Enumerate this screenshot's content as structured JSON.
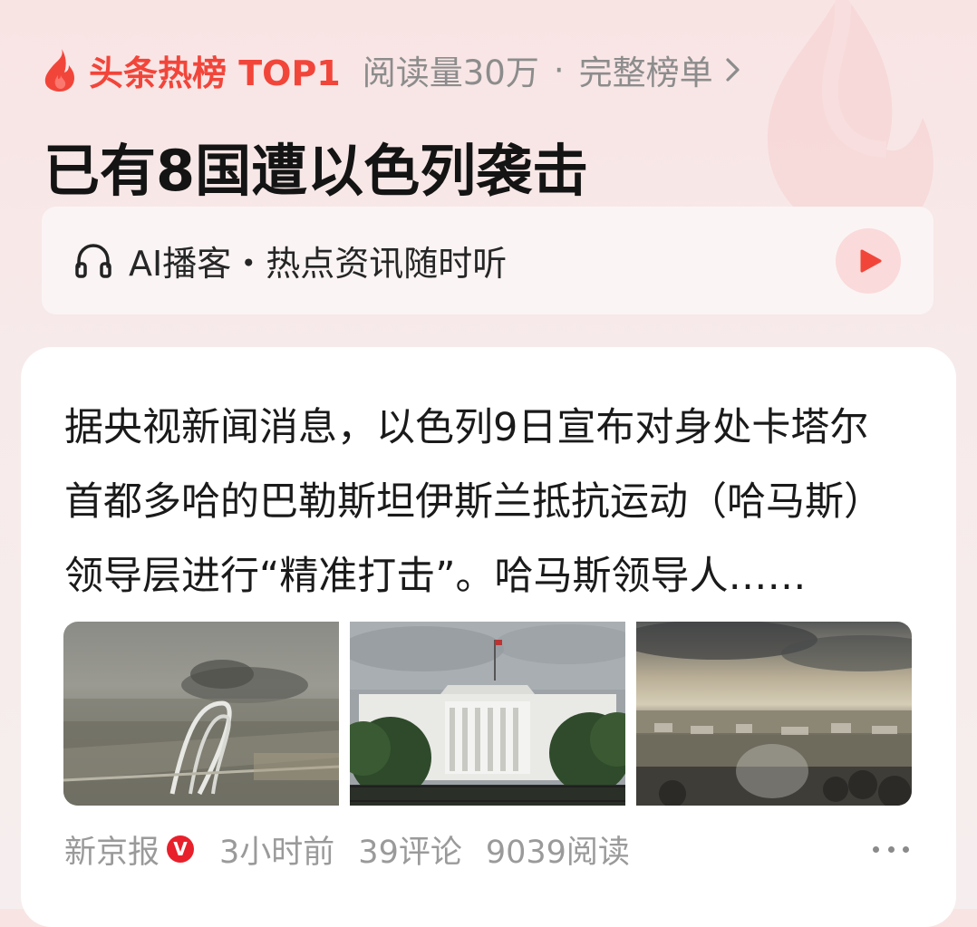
{
  "hot_list": {
    "label": "头条热榜 TOP1",
    "read_count": "阅读量30万",
    "separator": "·",
    "full_list_link": "完整榜单",
    "accent_color": "#f2453a"
  },
  "headline": "已有8国遭以色列袭击",
  "ai_podcast": {
    "text": "AI播客・热点资讯随时听",
    "icon": "headphone-icon",
    "play_icon": "play-icon"
  },
  "article": {
    "summary": "据央视新闻消息，以色列9日宣布对身处卡塔尔首都多哈的巴勒斯坦伊斯兰抵抗运动（哈马斯）领导层进行“精准打击”。哈马斯领导人……",
    "images": [
      {
        "icon": "city-smoke-photo"
      },
      {
        "icon": "white-house-photo"
      },
      {
        "icon": "camp-ruins-photo"
      }
    ],
    "source": "新京报",
    "verified_badge": "V",
    "time": "3小时前",
    "comments": "39评论",
    "reads": "9039阅读"
  }
}
